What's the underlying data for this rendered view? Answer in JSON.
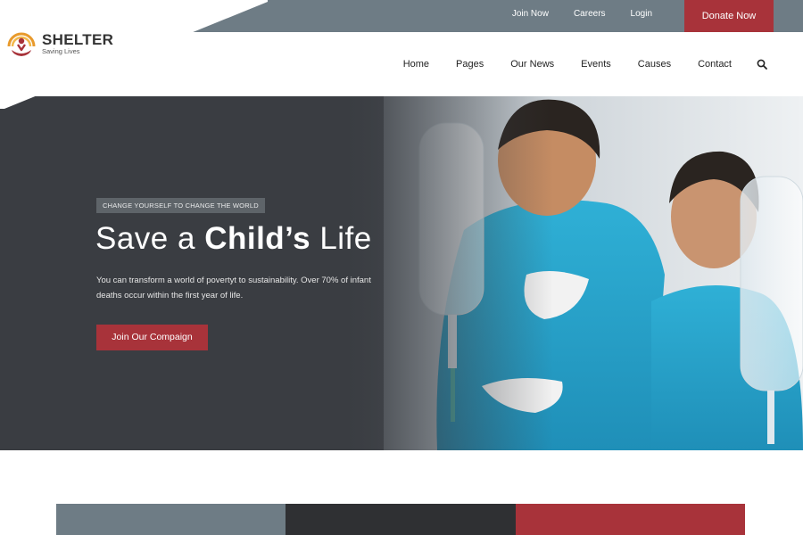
{
  "colors": {
    "accent": "#a8333a",
    "slate": "#6e7c85",
    "dark": "#2f3033"
  },
  "brand": {
    "name": "SHELTER",
    "tagline": "Saving Lives",
    "logo_icon": "hands-heart-sun-logo"
  },
  "topbar": {
    "links": [
      "Join Now",
      "Careers",
      "Login"
    ],
    "donate_label": "Donate Now"
  },
  "nav": {
    "items": [
      "Home",
      "Pages",
      "Our News",
      "Events",
      "Causes",
      "Contact"
    ],
    "search_icon": "search-icon"
  },
  "hero": {
    "badge": "CHANGE YOURSELF TO CHANGE THE WORLD",
    "title_prefix": "Save a",
    "title_bold": "Child’s",
    "title_suffix": "Life",
    "description": "You can transform a world of povertyt to sustainability. Over 70% of infant deaths occur within the first year of life.",
    "cta_label": "Join Our Compaign"
  }
}
